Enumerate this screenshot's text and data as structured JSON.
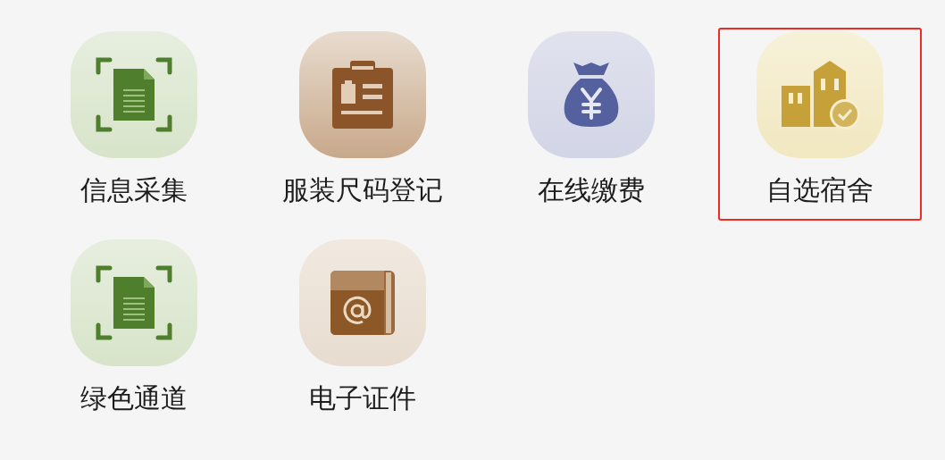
{
  "items": [
    {
      "label": "信息采集",
      "kind": "document",
      "highlighted": false
    },
    {
      "label": "服装尺码登记",
      "kind": "clipboard",
      "highlighted": false
    },
    {
      "label": "在线缴费",
      "kind": "moneybag",
      "highlighted": false
    },
    {
      "label": "自选宿舍",
      "kind": "buildings",
      "highlighted": true
    },
    {
      "label": "绿色通道",
      "kind": "document",
      "highlighted": false
    },
    {
      "label": "电子证件",
      "kind": "book",
      "highlighted": false
    }
  ]
}
